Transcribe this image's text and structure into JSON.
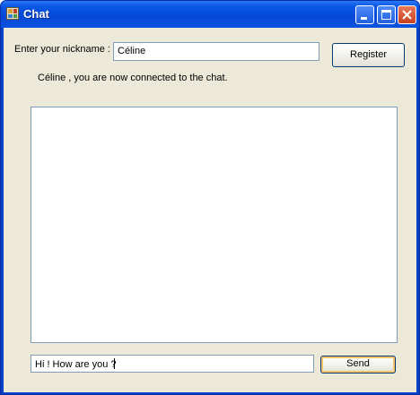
{
  "window": {
    "title": "Chat",
    "icons": [
      "app-icon",
      "minimize-icon",
      "maximize-icon",
      "close-icon"
    ]
  },
  "form": {
    "nickname_label": "Enter your nickname :",
    "nickname_value": "Céline",
    "register_label": "Register",
    "status_text": "Céline , you are now connected to the chat.",
    "chat_log": "",
    "message_value": "Hi ! How are you ?",
    "send_label": "Send"
  },
  "colors": {
    "titlebar": "#0a57e6",
    "client_background": "#ece9d8",
    "textbox_border": "#7f9db9",
    "close_button": "#c9401f"
  }
}
